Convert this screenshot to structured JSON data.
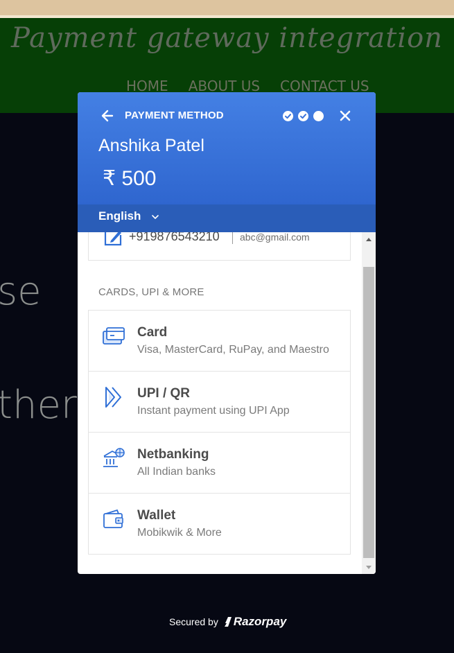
{
  "site": {
    "title": "Payment gateway integration",
    "nav": [
      "HOME",
      "ABOUT US",
      "CONTACT US"
    ],
    "bg_text_1": "se",
    "bg_text_2": "ther."
  },
  "modal": {
    "header_title": "PAYMENT METHOD",
    "merchant_name": "Anshika Patel",
    "amount": "₹ 500",
    "language": "English",
    "contact": {
      "phone": "+919876543210",
      "email": "abc@gmail.com"
    },
    "section_title": "CARDS, UPI & MORE",
    "methods": [
      {
        "name": "Card",
        "desc": "Visa, MasterCard, RuPay, and Maestro",
        "icon": "card-icon"
      },
      {
        "name": "UPI / QR",
        "desc": "Instant payment using UPI App",
        "icon": "upi-icon"
      },
      {
        "name": "Netbanking",
        "desc": "All Indian banks",
        "icon": "bank-icon"
      },
      {
        "name": "Wallet",
        "desc": "Mobikwik & More",
        "icon": "wallet-icon"
      }
    ],
    "steps_total": 3,
    "steps_completed": 2
  },
  "footer": {
    "secured_by": "Secured by",
    "brand": "Razorpay"
  },
  "colors": {
    "header_blue": "#3a73dc",
    "language_bar": "#2a5db8",
    "icon_blue": "#2f6fd6"
  }
}
